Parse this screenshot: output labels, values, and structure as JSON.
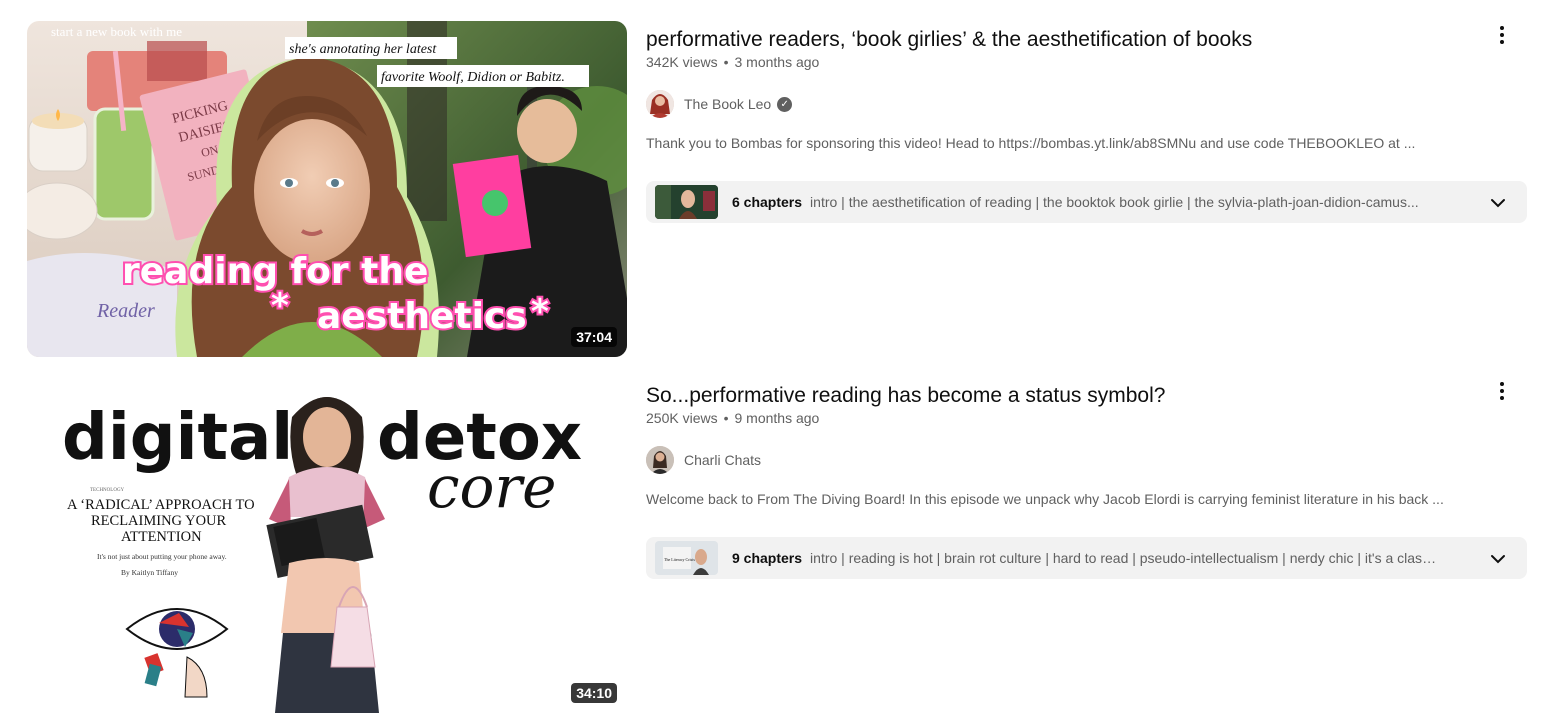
{
  "results": [
    {
      "title": "performative readers, ‘book girlies’ & the aesthetification of books",
      "views": "342K views",
      "age": "3 months ago",
      "channel": "The Book Leo",
      "verified": true,
      "description": "Thank you to Bombas for sponsoring this video! Head to https://bombas.yt.link/ab8SMNu and use code THEBOOKLEO at ...",
      "duration": "37:04",
      "chapters_count": "6 chapters",
      "chapters_list": "intro | the aesthetification of reading | the booktok book girlie | the sylvia-plath-joan-didion-camus...",
      "thumbnail_text": {
        "top_left": "start a new book with me",
        "caption_1": "she's annotating her latest",
        "caption_2": "favorite Woolf, Didion or Babitz.",
        "book_title": "PICKING DAISIES ON SUNDAYS",
        "overlay_1": "reading for the",
        "overlay_2": "aesthetics",
        "embroidery": "Reader"
      }
    },
    {
      "title": "So...performative reading has become a status symbol?",
      "views": "250K views",
      "age": "9 months ago",
      "channel": "Charli Chats",
      "verified": false,
      "description": "Welcome back to From The Diving Board! In this episode we unpack why Jacob Elordi is carrying feminist literature in his back ...",
      "duration": "34:10",
      "chapters_count": "9 chapters",
      "chapters_list": "intro | reading is hot | brain rot culture | hard to read | pseudo-intellectualism | nerdy chic | it's a class...",
      "thumbnail_text": {
        "word_1": "digital",
        "word_2": "detox",
        "script": "core",
        "section": "TECHNOLOGY",
        "headline": "A ‘RADICAL’ APPROACH TO RECLAIMING YOUR ATTENTION",
        "subhead": "It's not just about putting your phone away.",
        "byline": "By Kaitlyn Tiffany",
        "chapter_thumb_text": "The Literacy Crisis"
      }
    }
  ],
  "colors": {
    "pink": "#ff4fb0",
    "pink_light": "#ffd2ec",
    "green_outline": "#c8e59a",
    "title_text": "#0f0f0f",
    "meta_text": "#606060",
    "chapter_bg": "#f2f2f2"
  },
  "icons": {
    "menu": "more-vert-icon",
    "verified": "verified-check-icon",
    "chevron": "chevron-down-icon"
  }
}
